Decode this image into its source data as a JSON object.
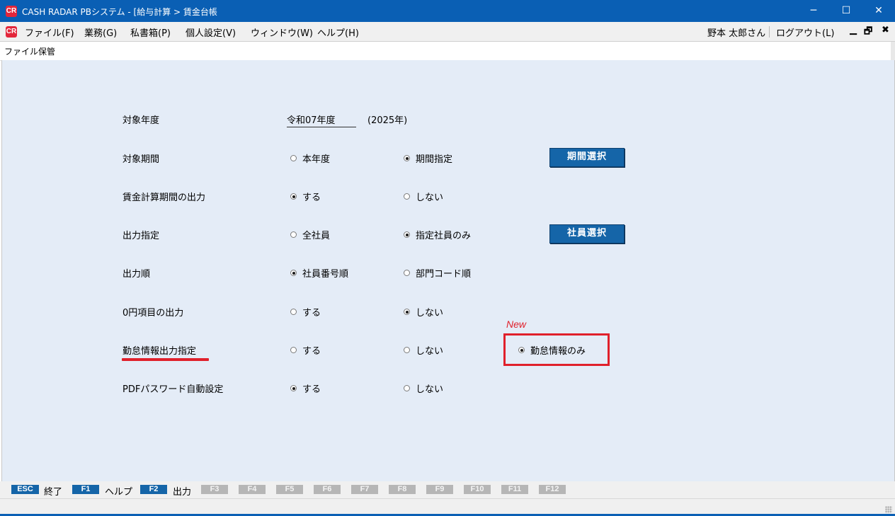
{
  "window": {
    "title": "CASH RADAR PBシステム - [給与計算 > 賃金台帳",
    "app_icon": "CR",
    "controls": {
      "minimize": "─",
      "maximize": "☐",
      "close": "✕"
    }
  },
  "menubar": {
    "items": [
      "ファイル(F)",
      "業務(G)",
      "私書箱(P)",
      "個人設定(V)",
      "ウィンドウ(W)",
      "ヘルプ(H)"
    ],
    "user": "野本 太郎さん",
    "logout": "ログアウト(L)",
    "mdi": {
      "minimize": "▁",
      "restore": "🗗",
      "close": "✖"
    }
  },
  "subheader": {
    "label": "ファイル保管"
  },
  "form": {
    "target_year": {
      "label": "対象年度",
      "value": "令和07年度",
      "western": "(2025年)"
    },
    "target_period": {
      "label": "対象期間",
      "options": [
        {
          "label": "本年度",
          "selected": false
        },
        {
          "label": "期間指定",
          "selected": true
        }
      ],
      "button": "期間選択"
    },
    "calc_period_output": {
      "label": "賃金計算期間の出力",
      "options": [
        {
          "label": "する",
          "selected": true
        },
        {
          "label": "しない",
          "selected": false
        }
      ]
    },
    "output_target": {
      "label": "出力指定",
      "options": [
        {
          "label": "全社員",
          "selected": false
        },
        {
          "label": "指定社員のみ",
          "selected": true
        }
      ],
      "button": "社員選択"
    },
    "output_order": {
      "label": "出力順",
      "options": [
        {
          "label": "社員番号順",
          "selected": true
        },
        {
          "label": "部門コード順",
          "selected": false
        }
      ]
    },
    "zero_items_output": {
      "label": "0円項目の出力",
      "options": [
        {
          "label": "する",
          "selected": false
        },
        {
          "label": "しない",
          "selected": true
        }
      ]
    },
    "attendance_output": {
      "label": "勤怠情報出力指定",
      "options": [
        {
          "label": "する",
          "selected": false
        },
        {
          "label": "しない",
          "selected": false
        },
        {
          "label": "勤怠情報のみ",
          "selected": true
        }
      ],
      "new_tag": "New"
    },
    "pdf_password": {
      "label": "PDFパスワード自動設定",
      "options": [
        {
          "label": "する",
          "selected": true
        },
        {
          "label": "しない",
          "selected": false
        }
      ]
    }
  },
  "fkeys": [
    {
      "key": "ESC",
      "label": "終了",
      "active": true
    },
    {
      "key": "F1",
      "label": "ヘルプ",
      "active": true
    },
    {
      "key": "F2",
      "label": "出力",
      "active": true
    },
    {
      "key": "F3",
      "label": "",
      "active": false
    },
    {
      "key": "F4",
      "label": "",
      "active": false
    },
    {
      "key": "F5",
      "label": "",
      "active": false
    },
    {
      "key": "F6",
      "label": "",
      "active": false
    },
    {
      "key": "F7",
      "label": "",
      "active": false
    },
    {
      "key": "F8",
      "label": "",
      "active": false
    },
    {
      "key": "F9",
      "label": "",
      "active": false
    },
    {
      "key": "F10",
      "label": "",
      "active": false
    },
    {
      "key": "F11",
      "label": "",
      "active": false
    },
    {
      "key": "F12",
      "label": "",
      "active": false
    }
  ],
  "colors": {
    "title_bar": "#0a5fb4",
    "panel": "#e4ecf7",
    "button": "#1565a8",
    "highlight": "#e0202b"
  }
}
